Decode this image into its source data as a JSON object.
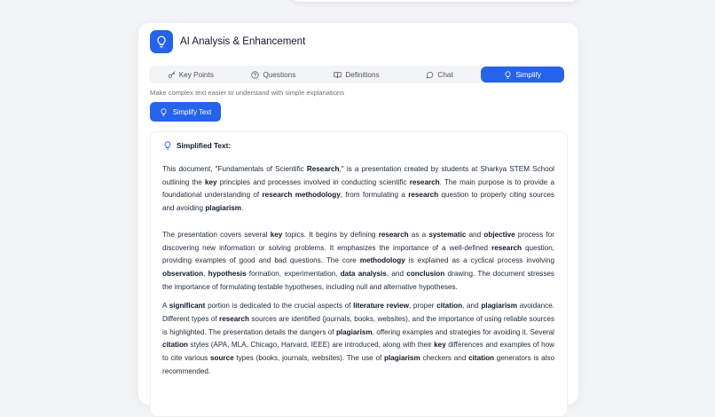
{
  "panel": {
    "title": "AI Analysis & Enhancement",
    "header_icon": "lightbulb-icon",
    "accent": "#2563eb"
  },
  "tabs": [
    {
      "label": "Key Points",
      "icon": "key-icon",
      "active": false
    },
    {
      "label": "Questions",
      "icon": "help-circle-icon",
      "active": false
    },
    {
      "label": "Definitions",
      "icon": "book-icon",
      "active": false
    },
    {
      "label": "Chat",
      "icon": "chat-icon",
      "active": false
    },
    {
      "label": "Simplify",
      "icon": "lightbulb-icon",
      "active": true
    }
  ],
  "simplify": {
    "hint": "Make complex text easier to understand with simple explanations",
    "button_label": "Simplify Text",
    "result_title": "Simplified Text:"
  },
  "paragraphs": [
    [
      {
        "t": "This document, \"Fundamentals of Scientific "
      },
      {
        "t": "Research",
        "b": true
      },
      {
        "t": ",\" is a presentation created by students at Sharkya STEM School outlining the "
      },
      {
        "t": "key",
        "b": true
      },
      {
        "t": " principles and processes involved in conducting scientific "
      },
      {
        "t": "research",
        "b": true
      },
      {
        "t": ". The main purpose is to provide a foundational understanding of "
      },
      {
        "t": "research methodology",
        "b": true
      },
      {
        "t": ", from formulating a "
      },
      {
        "t": "research",
        "b": true
      },
      {
        "t": " question to properly citing sources and avoiding "
      },
      {
        "t": "plagiarism",
        "b": true
      },
      {
        "t": "."
      }
    ],
    [
      {
        "t": "The presentation covers several "
      },
      {
        "t": "key",
        "b": true
      },
      {
        "t": " topics. It begins by defining "
      },
      {
        "t": "research",
        "b": true
      },
      {
        "t": " as a "
      },
      {
        "t": "systematic",
        "b": true
      },
      {
        "t": " and "
      },
      {
        "t": "objective",
        "b": true
      },
      {
        "t": " process for discovering new information or solving problems. It emphasizes the importance of a well-defined "
      },
      {
        "t": "research",
        "b": true
      },
      {
        "t": " question, providing examples of good and bad questions. The core "
      },
      {
        "t": "methodology",
        "b": true
      },
      {
        "t": " is explained as a cyclical process involving "
      },
      {
        "t": "observation",
        "b": true
      },
      {
        "t": ", "
      },
      {
        "t": "hypothesis",
        "b": true
      },
      {
        "t": " formation, experimentation, "
      },
      {
        "t": "data analysis",
        "b": true
      },
      {
        "t": ", and "
      },
      {
        "t": "conclusion",
        "b": true
      },
      {
        "t": " drawing. The document stresses the importance of formulating testable hypotheses, including null and alternative hypotheses."
      }
    ],
    [
      {
        "t": "A "
      },
      {
        "t": "significant",
        "b": true
      },
      {
        "t": " portion is dedicated to the crucial aspects of "
      },
      {
        "t": "literature review",
        "b": true
      },
      {
        "t": ", proper "
      },
      {
        "t": "citation",
        "b": true
      },
      {
        "t": ", and "
      },
      {
        "t": "plagiarism",
        "b": true
      },
      {
        "t": " avoidance. Different types of "
      },
      {
        "t": "research",
        "b": true
      },
      {
        "t": " sources are identified (journals, books, websites), and the importance of using reliable sources is highlighted. The presentation details the dangers of "
      },
      {
        "t": "plagiarism",
        "b": true
      },
      {
        "t": ", offering examples and strategies for avoiding it. Several "
      },
      {
        "t": "citation",
        "b": true
      },
      {
        "t": " styles (APA, MLA, Chicago, Harvard, IEEE) are introduced, along with their "
      },
      {
        "t": "key",
        "b": true
      },
      {
        "t": " differences and examples of how to cite various "
      },
      {
        "t": "source",
        "b": true
      },
      {
        "t": " types (books, journals, websites). The use of "
      },
      {
        "t": "plagiarism",
        "b": true
      },
      {
        "t": " checkers and "
      },
      {
        "t": "citation",
        "b": true
      },
      {
        "t": " generators is also recommended."
      }
    ]
  ]
}
